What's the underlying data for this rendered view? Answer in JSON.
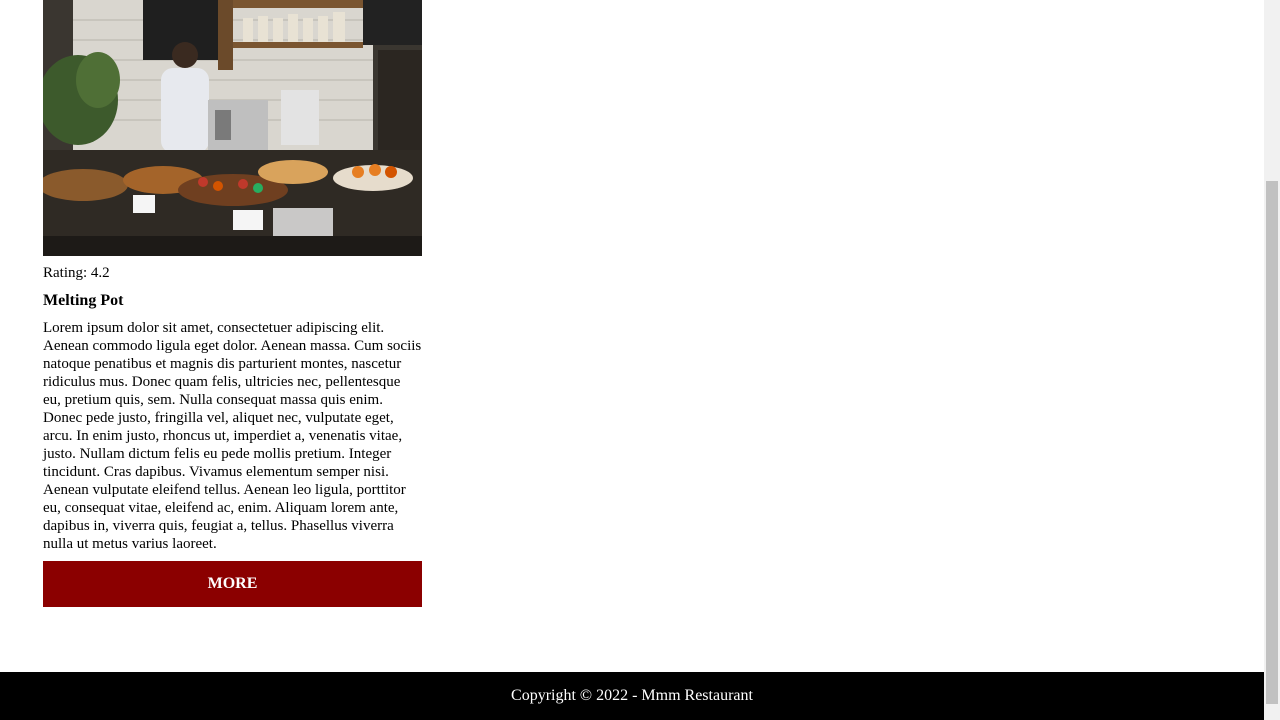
{
  "card": {
    "image_alt": "Restaurant counter photo",
    "rating": "Rating: 4.2",
    "title": "Melting Pot",
    "description": "Lorem ipsum dolor sit amet, consectetuer adipiscing elit. Aenean commodo ligula eget dolor. Aenean massa. Cum sociis natoque penatibus et magnis dis parturient montes, nascetur ridiculus mus. Donec quam felis, ultricies nec, pellentesque eu, pretium quis, sem. Nulla consequat massa quis enim. Donec pede justo, fringilla vel, aliquet nec, vulputate eget, arcu. In enim justo, rhoncus ut, imperdiet a, venenatis vitae, justo. Nullam dictum felis eu pede mollis pretium. Integer tincidunt. Cras dapibus. Vivamus elementum semper nisi. Aenean vulputate eleifend tellus. Aenean leo ligula, porttitor eu, consequat vitae, eleifend ac, enim. Aliquam lorem ante, dapibus in, viverra quis, feugiat a, tellus. Phasellus viverra nulla ut metus varius laoreet.",
    "button_label": "MORE"
  },
  "footer": {
    "copyright": "Copyright © 2022 - Mmm Restaurant"
  },
  "colors": {
    "button_bg": "#8b0000",
    "footer_bg": "#000000"
  }
}
